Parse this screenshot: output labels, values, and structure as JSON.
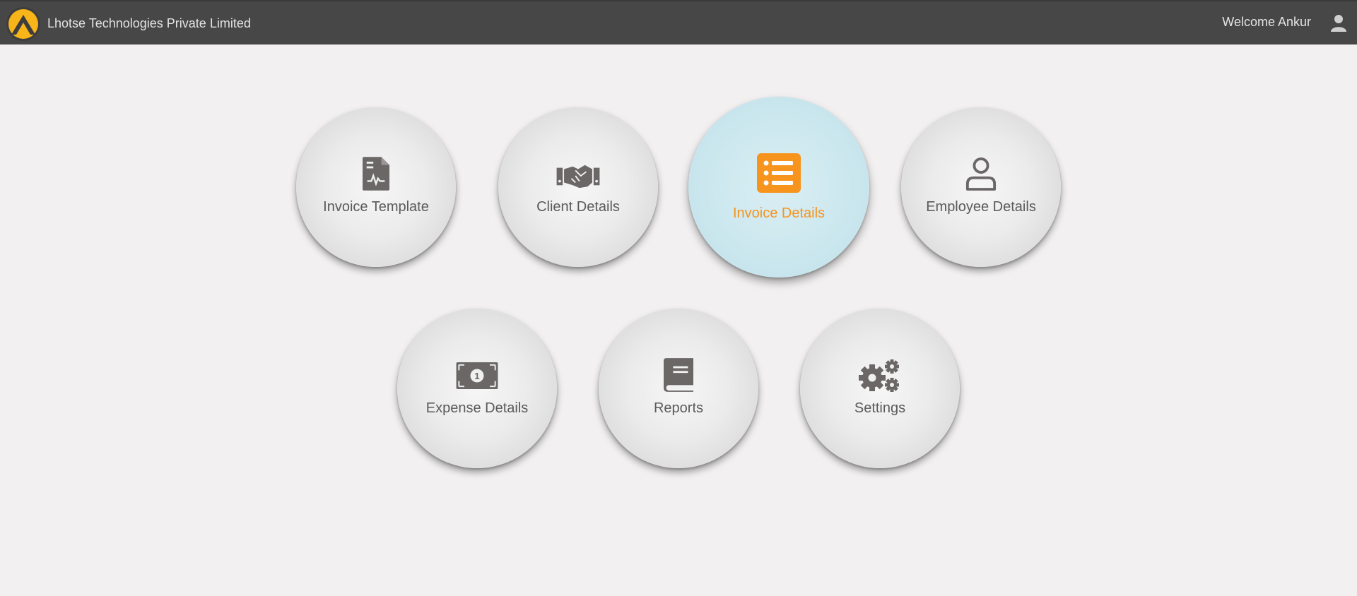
{
  "header": {
    "company_name": "Lhotse Technologies Private Limited",
    "welcome_text": "Welcome Ankur",
    "logo_icon": "lhotse-logo-icon",
    "user_icon": "user-icon"
  },
  "colors": {
    "header_bg": "#474747",
    "page_bg": "#f2f0f1",
    "tile_text": "#5a5a5a",
    "active_accent": "#f7941d",
    "active_tile_bg": "#cde8ef",
    "icon_gray": "#6b6767"
  },
  "tiles": [
    {
      "label": "Invoice Template",
      "icon": "invoice-document-icon",
      "active": false
    },
    {
      "label": "Client Details",
      "icon": "handshake-icon",
      "active": false
    },
    {
      "label": "Invoice Details",
      "icon": "list-details-icon",
      "active": true
    },
    {
      "label": "Employee Details",
      "icon": "person-icon",
      "active": false
    },
    {
      "label": "Expense Details",
      "icon": "banknote-icon",
      "active": false
    },
    {
      "label": "Reports",
      "icon": "book-icon",
      "active": false
    },
    {
      "label": "Settings",
      "icon": "gears-icon",
      "active": false
    }
  ]
}
